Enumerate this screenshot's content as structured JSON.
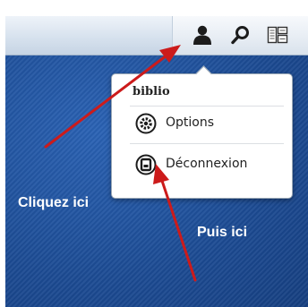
{
  "menu": {
    "username": "biblio",
    "items": [
      {
        "label": "Options",
        "icon": "gear-icon"
      },
      {
        "label": "Déconnexion",
        "icon": "logout-icon"
      }
    ]
  },
  "taskbar": {
    "icons": [
      "user-icon",
      "search-icon",
      "widgets-icon"
    ]
  },
  "annotations": {
    "first": "Cliquez ici",
    "second": "Puis ici"
  },
  "colors": {
    "arrow": "#cc1b1b",
    "desktop": "#1f4f9a",
    "annotation_text": "#ffffff"
  }
}
